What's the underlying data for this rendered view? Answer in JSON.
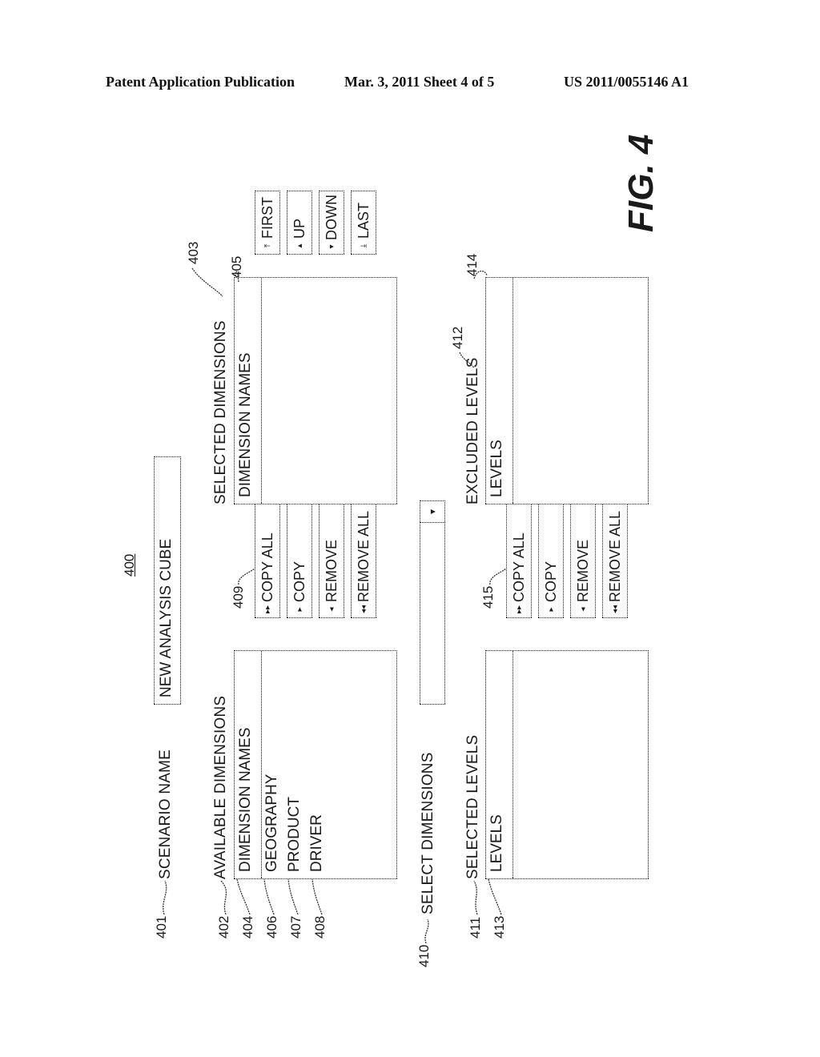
{
  "header": {
    "publication": "Patent Application Publication",
    "date_sheet": "Mar. 3, 2011   Sheet 4 of 5",
    "number": "US 2011/0055146 A1"
  },
  "figure": {
    "label": "FIG. 4",
    "ref": "400",
    "scenario": {
      "ref": "401",
      "label": "SCENARIO NAME",
      "value": "NEW ANALYSIS CUBE"
    },
    "available_dimensions": {
      "ref": "402",
      "label": "AVAILABLE DIMENSIONS",
      "header_ref": "404",
      "header": "DIMENSION NAMES",
      "items": [
        {
          "ref": "406",
          "label": "GEOGRAPHY"
        },
        {
          "ref": "407",
          "label": "PRODUCT"
        },
        {
          "ref": "408",
          "label": "DRIVER"
        }
      ]
    },
    "dimension_transfer_buttons": {
      "ref": "409",
      "buttons": [
        {
          "icon": "double-arrow-right-icon",
          "glyph": "▸▸",
          "label": "COPY ALL"
        },
        {
          "icon": "arrow-right-icon",
          "glyph": "▸",
          "label": "COPY"
        },
        {
          "icon": "arrow-left-icon",
          "glyph": "◂",
          "label": "REMOVE"
        },
        {
          "icon": "double-arrow-left-icon",
          "glyph": "◂◂",
          "label": "REMOVE ALL"
        }
      ]
    },
    "selected_dimensions": {
      "ref": "403",
      "label": "SELECTED DIMENSIONS",
      "header_ref": "405",
      "header": "DIMENSION NAMES",
      "items": []
    },
    "order_buttons": [
      {
        "icon": "move-first-icon",
        "glyph": "⤒",
        "label": "FIRST"
      },
      {
        "icon": "move-up-icon",
        "glyph": "▴",
        "label": "UP"
      },
      {
        "icon": "move-down-icon",
        "glyph": "▾",
        "label": "DOWN"
      },
      {
        "icon": "move-last-icon",
        "glyph": "⤓",
        "label": "LAST"
      }
    ],
    "select_dimensions": {
      "ref": "410",
      "label": "SELECT DIMENSIONS",
      "value": "",
      "dropdown_glyph": "▾"
    },
    "selected_levels": {
      "ref": "411",
      "label": "SELECTED LEVELS",
      "header_ref": "413",
      "header": "LEVELS",
      "items": []
    },
    "level_transfer_buttons": {
      "ref": "415",
      "buttons": [
        {
          "icon": "double-arrow-right-icon",
          "glyph": "▸▸",
          "label": "COPY ALL"
        },
        {
          "icon": "arrow-right-icon",
          "glyph": "▸",
          "label": "COPY"
        },
        {
          "icon": "arrow-left-icon",
          "glyph": "◂",
          "label": "REMOVE"
        },
        {
          "icon": "double-arrow-left-icon",
          "glyph": "◂◂",
          "label": "REMOVE ALL"
        }
      ]
    },
    "excluded_levels": {
      "ref": "412",
      "label": "EXCLUDED LEVELS",
      "header_ref": "414",
      "header": "LEVELS",
      "items": []
    }
  }
}
